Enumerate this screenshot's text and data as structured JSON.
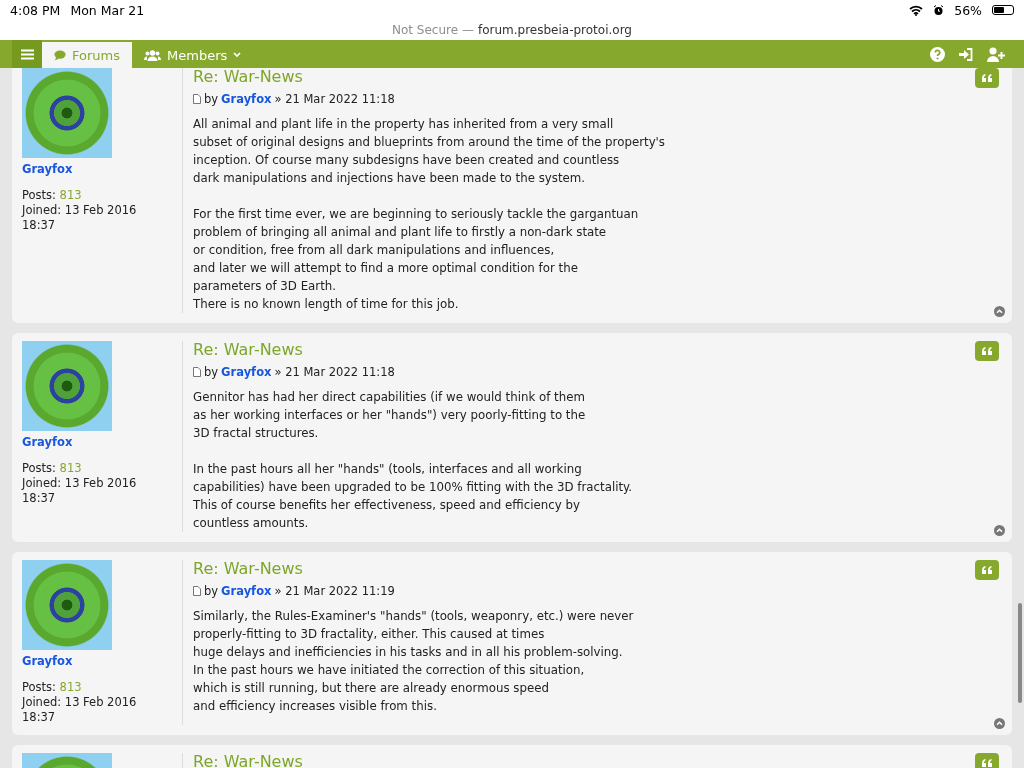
{
  "status_bar": {
    "time": "4:08 PM",
    "date": "Mon Mar 21",
    "battery": "56%"
  },
  "address_bar": {
    "security": "Not Secure —",
    "domain": "forum.presbeia-protoi.org"
  },
  "nav": {
    "tabs": [
      {
        "label": "Forums",
        "kind": "forums",
        "selected": true
      },
      {
        "label": "Members",
        "kind": "members",
        "selected": false
      }
    ]
  },
  "posts": [
    {
      "title": "Re: War-News",
      "by_label": "by",
      "author": "Grayfox",
      "profile_name": "Grayfox",
      "date": "» 21 Mar 2022 11:18",
      "posts_label": "Posts:",
      "posts_count": "813",
      "joined": "Joined: 13 Feb 2016 18:37",
      "body": [
        "All animal and plant life in the property has inherited from a very small\nsubset of original designs and blueprints from around the time of the property's\ninception. Of course many subdesigns have been created and countless\ndark manipulations and injections have been made to the system.",
        "For the first time ever, we are beginning to seriously tackle the gargantuan\nproblem of bringing all animal and plant life to firstly a non-dark state\nor condition, free from all dark manipulations and influences,\nand later we will attempt to find a more optimal condition for the\nparameters of 3D Earth.\nThere is no known length of time for this job."
      ]
    },
    {
      "title": "Re: War-News",
      "by_label": "by",
      "author": "Grayfox",
      "profile_name": "Grayfox",
      "date": "» 21 Mar 2022 11:18",
      "posts_label": "Posts:",
      "posts_count": "813",
      "joined": "Joined: 13 Feb 2016 18:37",
      "body": [
        "Gennitor has had her direct capabilities (if we would think of them\nas her working interfaces or her \"hands\") very poorly-fitting to the\n3D fractal structures.",
        "In the past hours all her \"hands\" (tools, interfaces and all working\ncapabilities) have been upgraded to be 100% fitting with the 3D fractality.\nThis of course benefits her effectiveness, speed and efficiency by\ncountless amounts."
      ]
    },
    {
      "title": "Re: War-News",
      "by_label": "by",
      "author": "Grayfox",
      "profile_name": "Grayfox",
      "date": "» 21 Mar 2022 11:19",
      "posts_label": "Posts:",
      "posts_count": "813",
      "joined": "Joined: 13 Feb 2016 18:37",
      "body": [
        "Similarly, the Rules-Examiner's \"hands\" (tools, weaponry, etc.) were never\nproperly-fitting to 3D fractality, either. This caused at times\nhuge delays and inefficiencies in his tasks and in all his problem-solving.\nIn the past hours we have initiated the correction of this situation,\nwhich is still running, but there are already enormous speed\nand efficiency increases visible from this."
      ]
    },
    {
      "title": "Re: War-News"
    }
  ]
}
